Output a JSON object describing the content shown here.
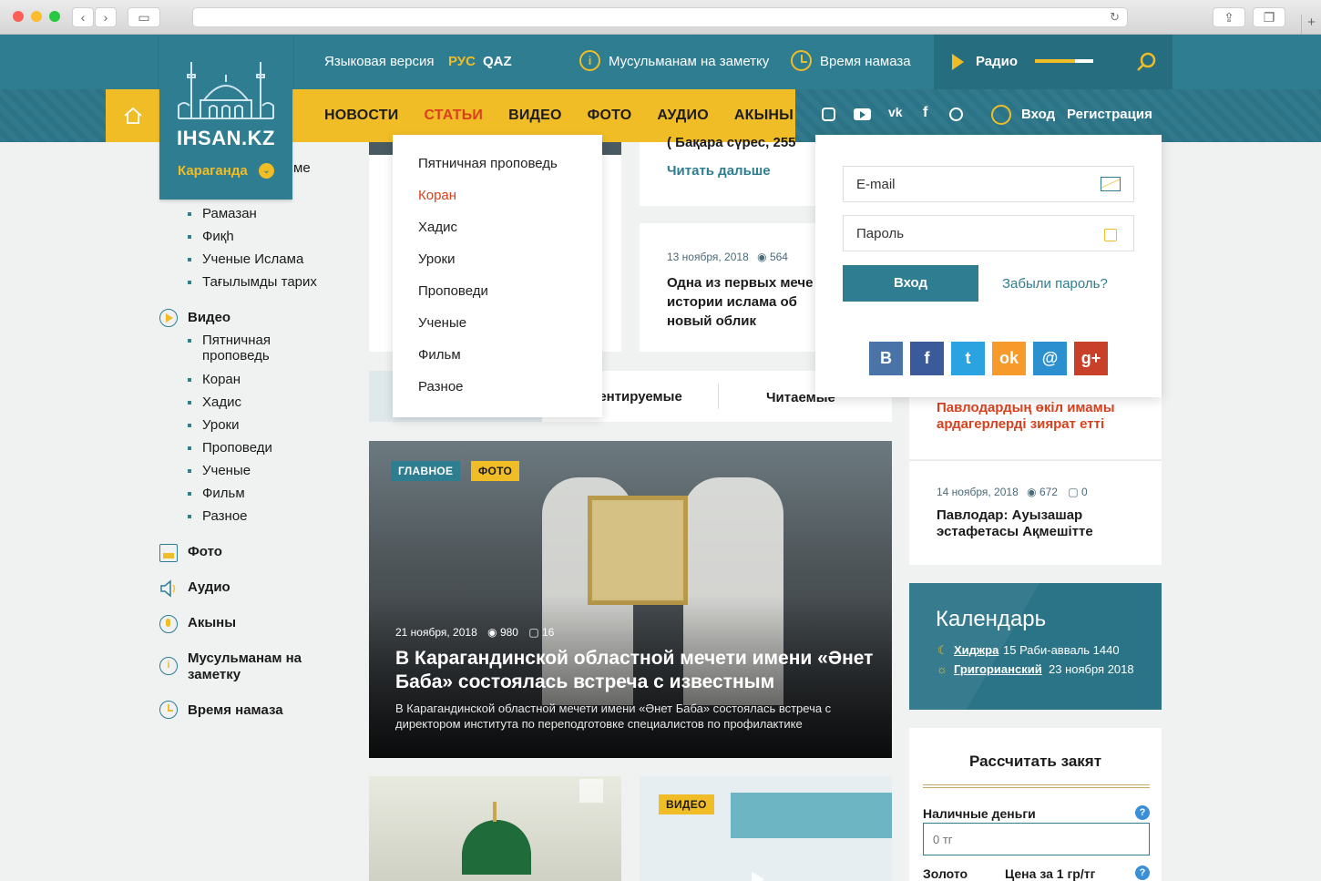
{
  "header": {
    "lang_label": "Языковая версия",
    "lang_ru": "РУС",
    "lang_kz": "QAZ",
    "muslim_note": "Мусульманам на заметку",
    "prayer_time": "Время намаза",
    "radio": "Радио"
  },
  "logo": {
    "name": "IHSAN.KZ",
    "city": "Караганда"
  },
  "nav": {
    "items": [
      "НОВОСТИ",
      "СТАТЬИ",
      "ВИДЕО",
      "ФОТО",
      "АУДИО",
      "АКЫНЫ"
    ],
    "active": "СТАТЬИ",
    "login": "Вход",
    "register": "Регистрация"
  },
  "dropdown": {
    "items": [
      "Пятничная проповедь",
      "Коран",
      "Хадис",
      "Уроки",
      "Проповеди",
      "Ученые",
      "Фильм",
      "Разное"
    ],
    "active": "Коран"
  },
  "sidebar": {
    "partial_text": "ме",
    "articles_sub": [
      "Рамазан",
      "Фиқһ",
      "Ученые Ислама",
      "Тағылымды тарих"
    ],
    "video": {
      "title": "Видео",
      "items": [
        "Пятничная проповедь",
        "Коран",
        "Хадис",
        "Уроки",
        "Проповеди",
        "Ученые",
        "Фильм",
        "Разное"
      ]
    },
    "photo": "Фото",
    "audio": "Аудио",
    "akyny": "Акыны",
    "muslim_note": "Мусульманам на заметку",
    "prayer_time": "Время намаза"
  },
  "articles": {
    "top_partial": "( Бақара сүрес, 255",
    "read_more": "Читать дальше",
    "card2": {
      "date": "13 ноября, 2018",
      "views": "564",
      "title": "Одна из первых мече в истории ислама об новый облик"
    }
  },
  "tabs": {
    "commented": "Комментируемые",
    "read": "Читаемые"
  },
  "main_story": {
    "tag1": "ГЛАВНОЕ",
    "tag2": "ФОТО",
    "date": "21 ноября, 2018",
    "views": "980",
    "comments": "16",
    "title": "В Карагандинской областной мечети имени «Әнет Баба» состоялась встреча с известным",
    "summary": "В Карагандинской областной мечети имени «Әнет Баба» состоялась встреча с директором института по переподготовке специалистов по профилактике"
  },
  "video_tag": "ВИДЕО",
  "login_form": {
    "email_placeholder": "E-mail",
    "password_placeholder": "Пароль",
    "submit": "Вход",
    "forgot": "Забыли пароль?"
  },
  "news_right": {
    "item1_title": "Павлодардың өкіл имамы ардагерлерді зиярат етті",
    "item2": {
      "date": "14 ноября, 2018",
      "views": "672",
      "comments": "0",
      "title": "Павлодар: Ауызашар эстафетасы Ақмешітте"
    }
  },
  "calendar": {
    "title": "Календарь",
    "hijri_label": "Хиджра",
    "hijri_value": "15 Раби-авваль 1440",
    "greg_label": "Григорианский",
    "greg_value": "23 ноября 2018"
  },
  "zakat": {
    "title": "Рассчитать закят",
    "cash_label": "Наличные деньги",
    "cash_placeholder": "0 тг",
    "gold_label": "Золото",
    "price_label": "Цена за 1 гр/тг"
  },
  "colors": {
    "teal": "#2e7d90",
    "yellow": "#f0bd26",
    "red": "#d9411e"
  }
}
